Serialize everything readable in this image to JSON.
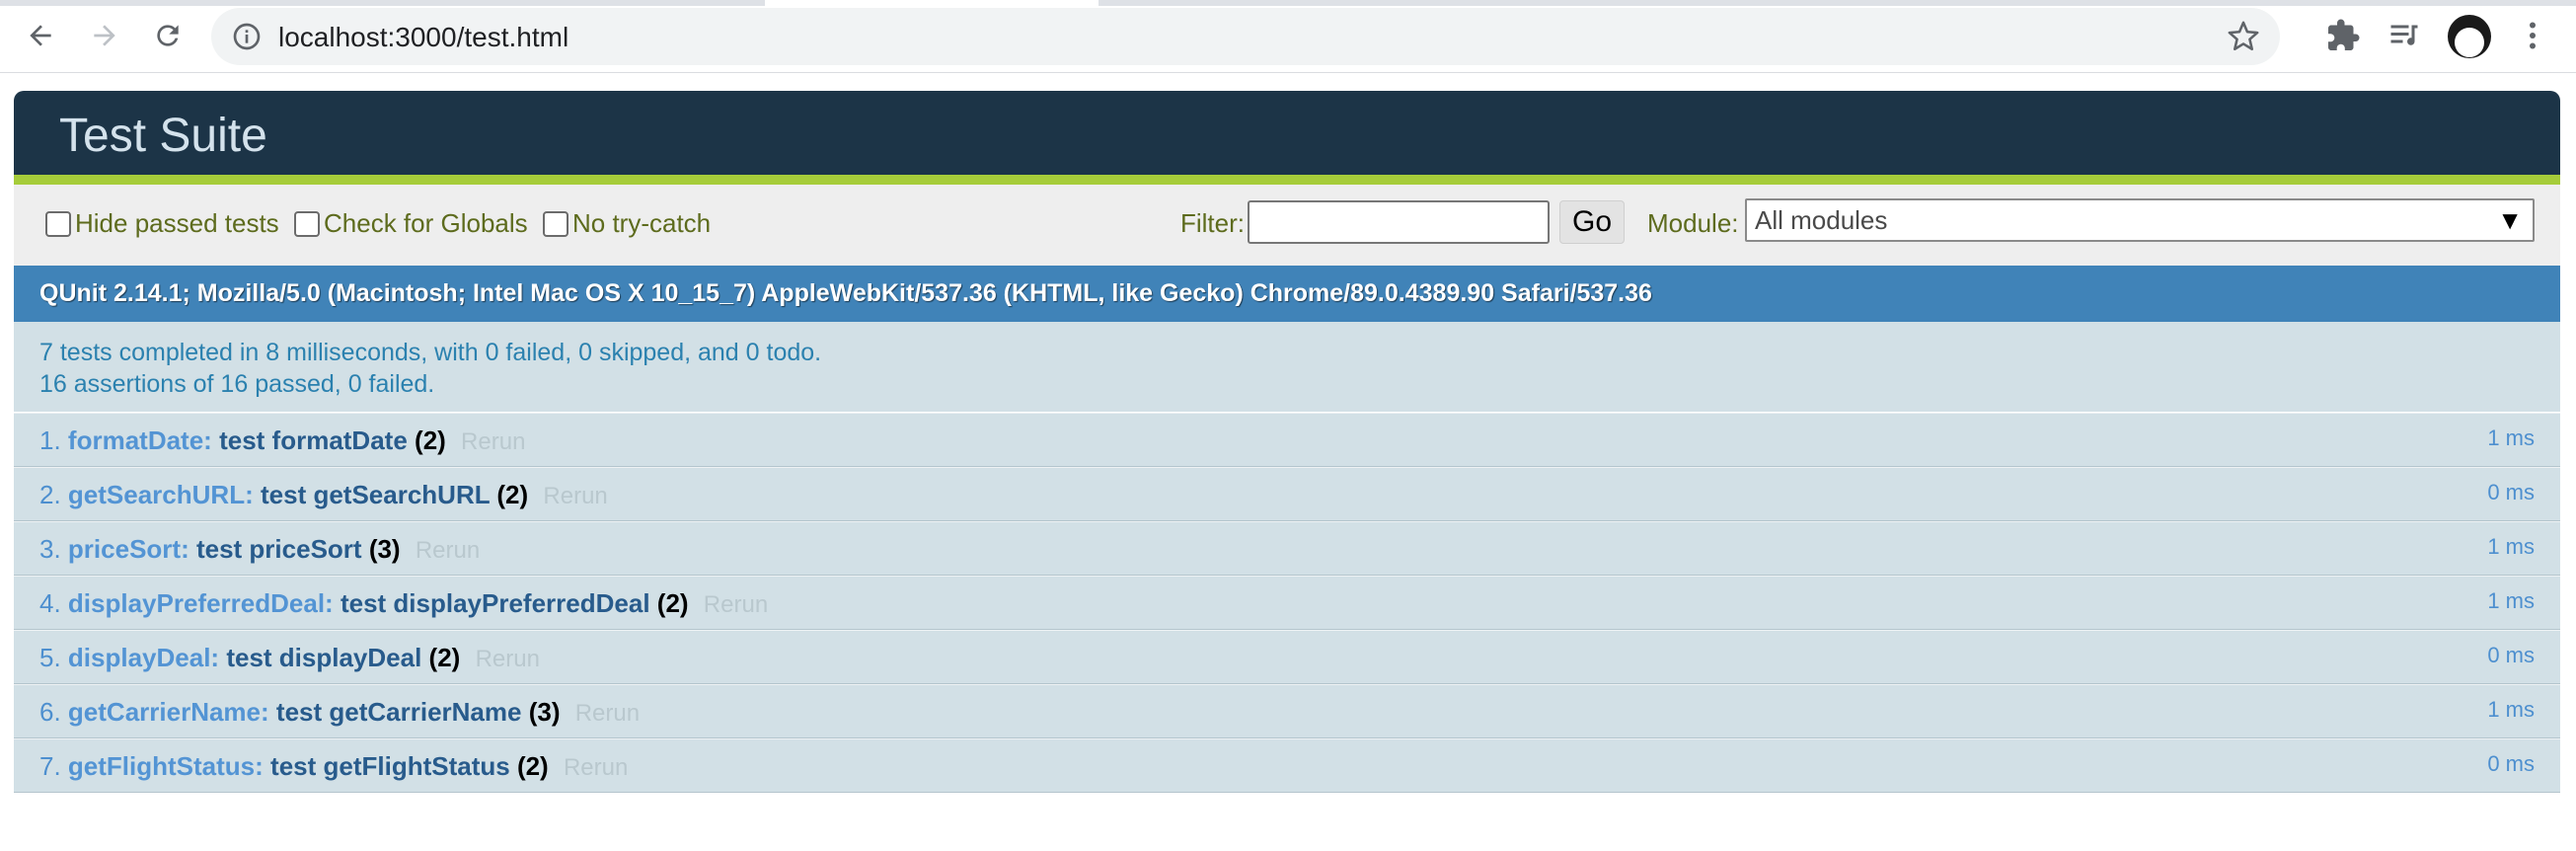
{
  "browser": {
    "url": "localhost:3000/test.html"
  },
  "page": {
    "title": "Test Suite"
  },
  "toolbar": {
    "hide_passed_label": "Hide passed tests",
    "check_globals_label": "Check for Globals",
    "no_try_catch_label": "No try-catch",
    "filter_label": "Filter:",
    "filter_value": "",
    "go_label": "Go",
    "module_label": "Module:",
    "module_selected": "All modules"
  },
  "user_agent": "QUnit 2.14.1; Mozilla/5.0 (Macintosh; Intel Mac OS X 10_15_7) AppleWebKit/537.36 (KHTML, like Gecko) Chrome/89.0.4389.90 Safari/537.36",
  "result": {
    "line1": "7 tests completed in 8 milliseconds, with 0 failed, 0 skipped, and 0 todo.",
    "line2": "16 assertions of 16 passed, 0 failed."
  },
  "tests": [
    {
      "num": "1.",
      "module": "formatDate:",
      "name": "test formatDate",
      "count": "(2)",
      "rerun": "Rerun",
      "runtime": "1 ms"
    },
    {
      "num": "2.",
      "module": "getSearchURL:",
      "name": "test getSearchURL",
      "count": "(2)",
      "rerun": "Rerun",
      "runtime": "0 ms"
    },
    {
      "num": "3.",
      "module": "priceSort:",
      "name": "test priceSort",
      "count": "(3)",
      "rerun": "Rerun",
      "runtime": "1 ms"
    },
    {
      "num": "4.",
      "module": "displayPreferredDeal:",
      "name": "test displayPreferredDeal",
      "count": "(2)",
      "rerun": "Rerun",
      "runtime": "1 ms"
    },
    {
      "num": "5.",
      "module": "displayDeal:",
      "name": "test displayDeal",
      "count": "(2)",
      "rerun": "Rerun",
      "runtime": "0 ms"
    },
    {
      "num": "6.",
      "module": "getCarrierName:",
      "name": "test getCarrierName",
      "count": "(3)",
      "rerun": "Rerun",
      "runtime": "1 ms"
    },
    {
      "num": "7.",
      "module": "getFlightStatus:",
      "name": "test getFlightStatus",
      "count": "(2)",
      "rerun": "Rerun",
      "runtime": "0 ms"
    }
  ],
  "colors": {
    "header_bg": "#1c3447",
    "header_accent": "#a6cc3a",
    "user_agent_bg": "#4083b8",
    "result_bg": "#d2e0e6"
  }
}
